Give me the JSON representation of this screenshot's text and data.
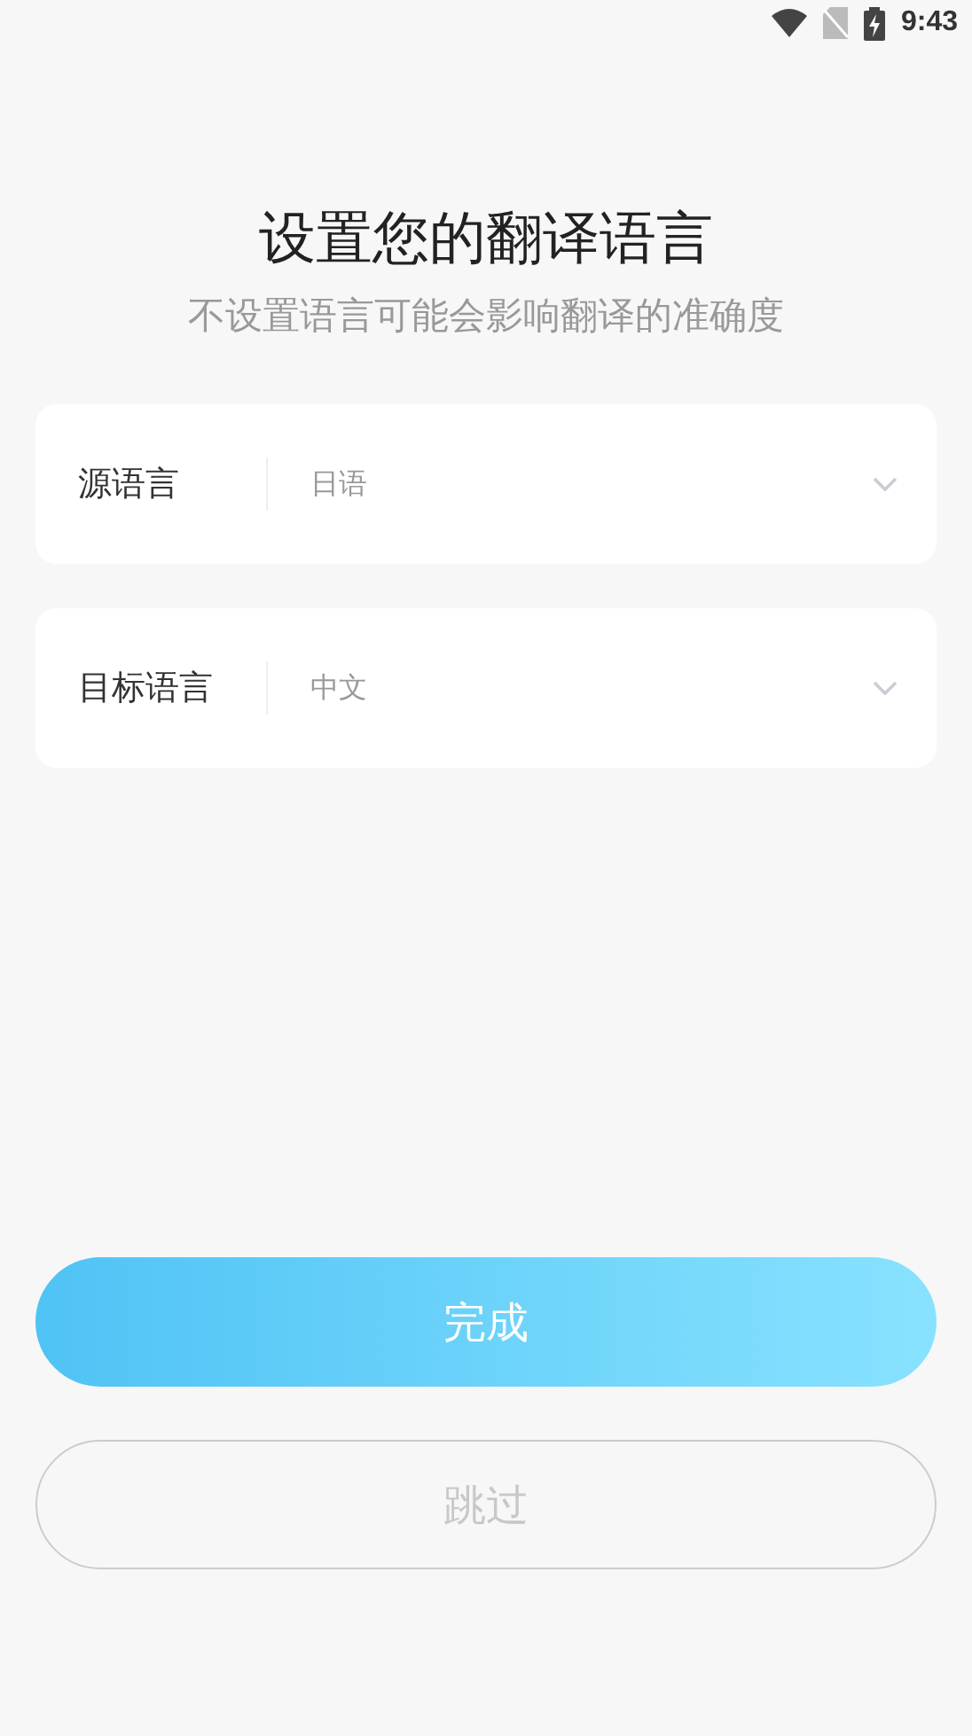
{
  "status_bar": {
    "time": "9:43"
  },
  "title": "设置您的翻译语言",
  "subtitle": "不设置语言可能会影响翻译的准确度",
  "selectors": [
    {
      "label": "源语言",
      "value": "日语"
    },
    {
      "label": "目标语言",
      "value": "中文"
    }
  ],
  "buttons": [
    {
      "label": "完成",
      "kind": "primary"
    },
    {
      "label": "跳过",
      "kind": "secondary"
    }
  ]
}
